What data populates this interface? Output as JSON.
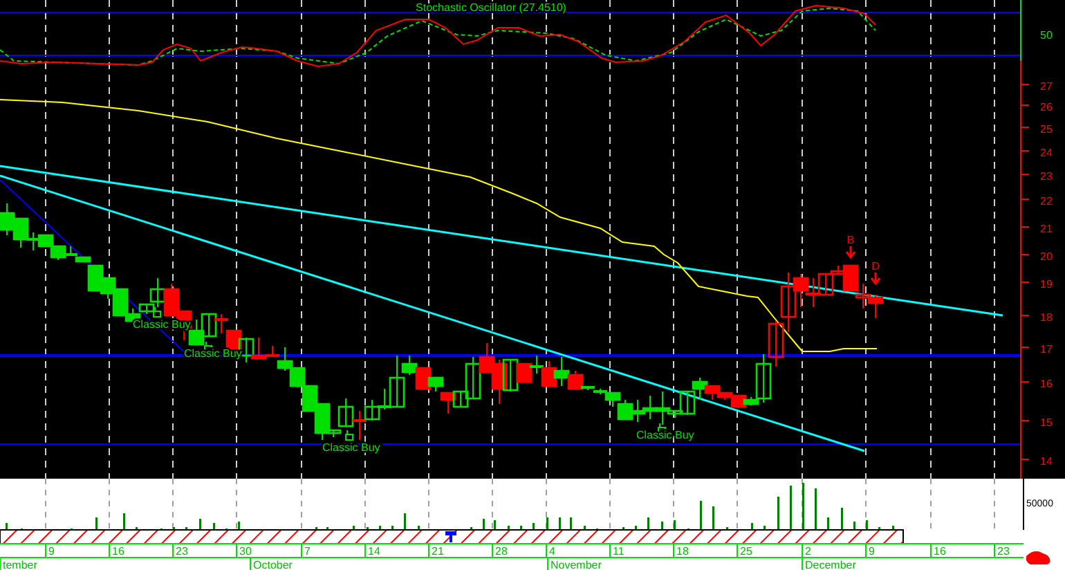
{
  "stochastic_panel": {
    "title": "Stochastic Oscillator (27.4510)",
    "axis_labels": [
      "50"
    ]
  },
  "price_panel": {
    "axis_labels": [
      "27",
      "26",
      "25",
      "24",
      "23",
      "22",
      "21",
      "20",
      "19",
      "18",
      "17",
      "16",
      "15",
      "14"
    ],
    "signals": [
      {
        "label": "Classic Buy"
      },
      {
        "label": "Classic Buy"
      },
      {
        "label": "Classic Buy"
      },
      {
        "label": "Classic Buy"
      }
    ],
    "markers": [
      {
        "label": "B"
      },
      {
        "label": "D"
      }
    ]
  },
  "volume_panel": {
    "axis_labels": [
      "50000"
    ]
  },
  "date_axis": {
    "days": [
      "9",
      "16",
      "23",
      "30",
      "7",
      "14",
      "21",
      "28",
      "4",
      "11",
      "18",
      "25",
      "2",
      "9",
      "16",
      "23"
    ],
    "months": [
      "tember",
      "October",
      "November",
      "December"
    ]
  }
}
